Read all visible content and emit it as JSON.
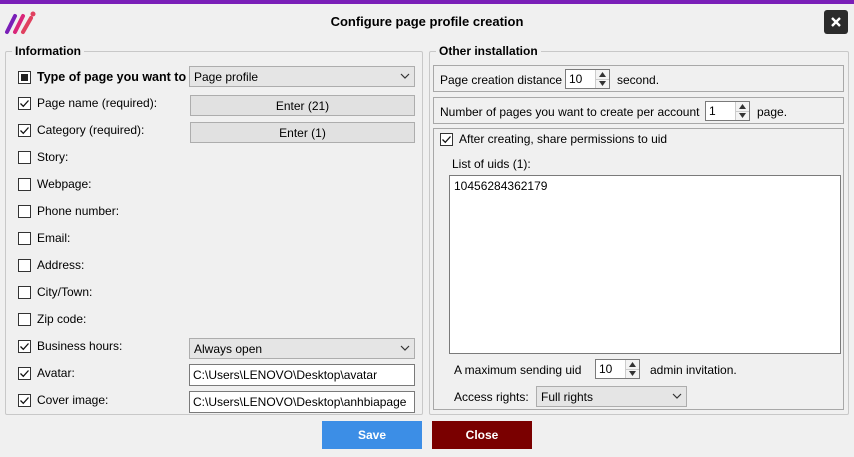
{
  "window": {
    "title": "Configure page profile creation",
    "logo_icon": "app-logo-icon",
    "close_icon": "close-icon"
  },
  "information": {
    "title": "Information",
    "page_type": {
      "label": "Type of page you want to",
      "value": "Page profile"
    },
    "fields": [
      {
        "label": "Page name (required):",
        "checked": true
      },
      {
        "label": "Category (required):",
        "checked": true
      },
      {
        "label": "Story:",
        "checked": false
      },
      {
        "label": "Webpage:",
        "checked": false
      },
      {
        "label": "Phone number:",
        "checked": false
      },
      {
        "label": "Email:",
        "checked": false
      },
      {
        "label": "Address:",
        "checked": false
      },
      {
        "label": "City/Town:",
        "checked": false
      },
      {
        "label": "Zip code:",
        "checked": false
      },
      {
        "label": "Business hours:",
        "checked": true
      },
      {
        "label": "Avatar:",
        "checked": true
      },
      {
        "label": "Cover image:",
        "checked": true
      }
    ],
    "page_name_button": "Enter (21)",
    "category_button": "Enter (1)",
    "business_hours_value": "Always open",
    "avatar_path": "C:\\Users\\LENOVO\\Desktop\\avatar",
    "cover_path": "C:\\Users\\LENOVO\\Desktop\\anhbiapage"
  },
  "other": {
    "title": "Other installation",
    "distance": {
      "label": "Page creation distance",
      "value": "10",
      "unit": "second."
    },
    "pages_per_account": {
      "label": "Number of pages you want to create per account",
      "value": "1",
      "unit": "page."
    },
    "share": {
      "label": "After creating, share permissions to uid",
      "checked": true,
      "list_label": "List of uids (1):",
      "uids": [
        "10456284362179"
      ]
    },
    "max_uid": {
      "label": "A maximum sending uid",
      "value": "10",
      "unit": "admin invitation."
    },
    "access": {
      "label": "Access rights:",
      "value": "Full rights"
    }
  },
  "footer": {
    "save": "Save",
    "close": "Close"
  },
  "colors": {
    "accent": "#7a1fb8",
    "save": "#3c8ee6",
    "close": "#7a0000"
  }
}
